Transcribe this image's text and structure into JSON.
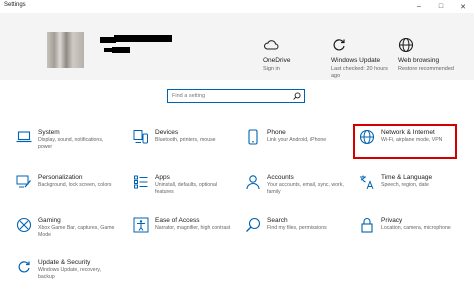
{
  "window": {
    "title": "Settings"
  },
  "colors": {
    "accent": "#0063b1",
    "highlight": "#d40000",
    "header_bg": "#f4f4f4"
  },
  "quick_actions": [
    {
      "title": "OneDrive",
      "subtitle": "Sign in",
      "icon": "cloud-icon"
    },
    {
      "title": "Windows Update",
      "subtitle": "Last checked: 20 hours ago",
      "icon": "update-icon"
    },
    {
      "title": "Web browsing",
      "subtitle": "Restore recommended",
      "icon": "globe-icon"
    }
  ],
  "search": {
    "placeholder": "Find a setting"
  },
  "categories": [
    {
      "name": "System",
      "desc": "Display, sound, notifications, power",
      "icon": "laptop-icon"
    },
    {
      "name": "Devices",
      "desc": "Bluetooth, printers, mouse",
      "icon": "devices-icon"
    },
    {
      "name": "Phone",
      "desc": "Link your Android, iPhone",
      "icon": "phone-icon"
    },
    {
      "name": "Network & Internet",
      "desc": "Wi-Fi, airplane mode, VPN",
      "icon": "globe-icon"
    },
    {
      "name": "Personalization",
      "desc": "Background, lock screen, colors",
      "icon": "paintbrush-icon"
    },
    {
      "name": "Apps",
      "desc": "Uninstall, defaults, optional features",
      "icon": "apps-list-icon"
    },
    {
      "name": "Accounts",
      "desc": "Your accounts, email, sync, work, family",
      "icon": "person-icon"
    },
    {
      "name": "Time & Language",
      "desc": "Speech, region, date",
      "icon": "time-language-icon"
    },
    {
      "name": "Gaming",
      "desc": "Xbox Game Bar, captures, Game Mode",
      "icon": "xbox-icon"
    },
    {
      "name": "Ease of Access",
      "desc": "Narrator, magnifier, high contrast",
      "icon": "ease-of-access-icon"
    },
    {
      "name": "Search",
      "desc": "Find my files, permissions",
      "icon": "search-icon"
    },
    {
      "name": "Privacy",
      "desc": "Location, camera, microphone",
      "icon": "lock-icon"
    },
    {
      "name": "Update & Security",
      "desc": "Windows Update, recovery, backup",
      "icon": "update-icon"
    }
  ]
}
